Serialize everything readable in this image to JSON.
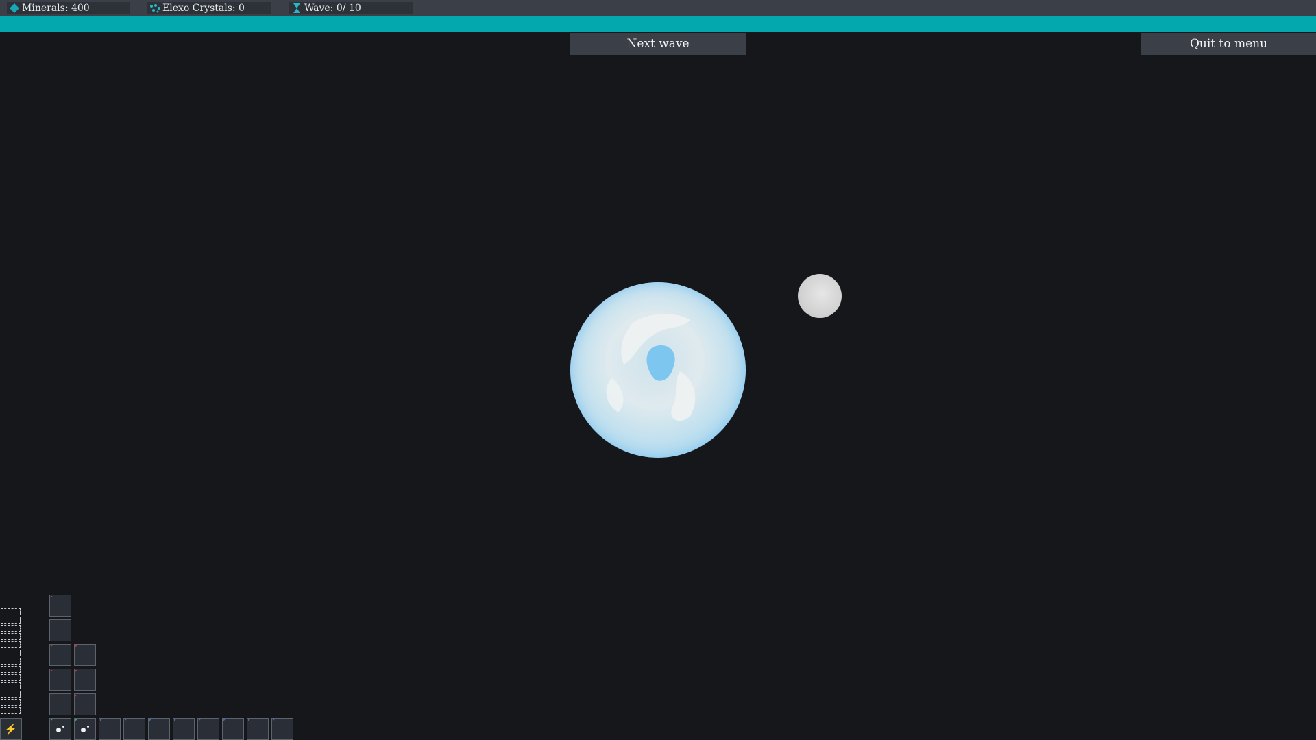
{
  "hud": {
    "minerals_label": "Minerals: 400",
    "crystals_label": "Elexo Crystals: 0",
    "wave_label": "Wave: 0/ 10"
  },
  "buttons": {
    "next_wave": "Next wave",
    "quit": "Quit to menu"
  },
  "colors": {
    "accent": "#02a8ad",
    "background": "#15171b",
    "bar": "#3b3f47",
    "slot_red": "#c4323a",
    "slot_blue": "#2f73c8",
    "slot_green": "#2fae58"
  },
  "icons": {
    "minerals": "diamond-icon",
    "crystals": "crystal-cluster-icon",
    "wave": "hourglass-icon",
    "ability": "lightning-icon"
  }
}
